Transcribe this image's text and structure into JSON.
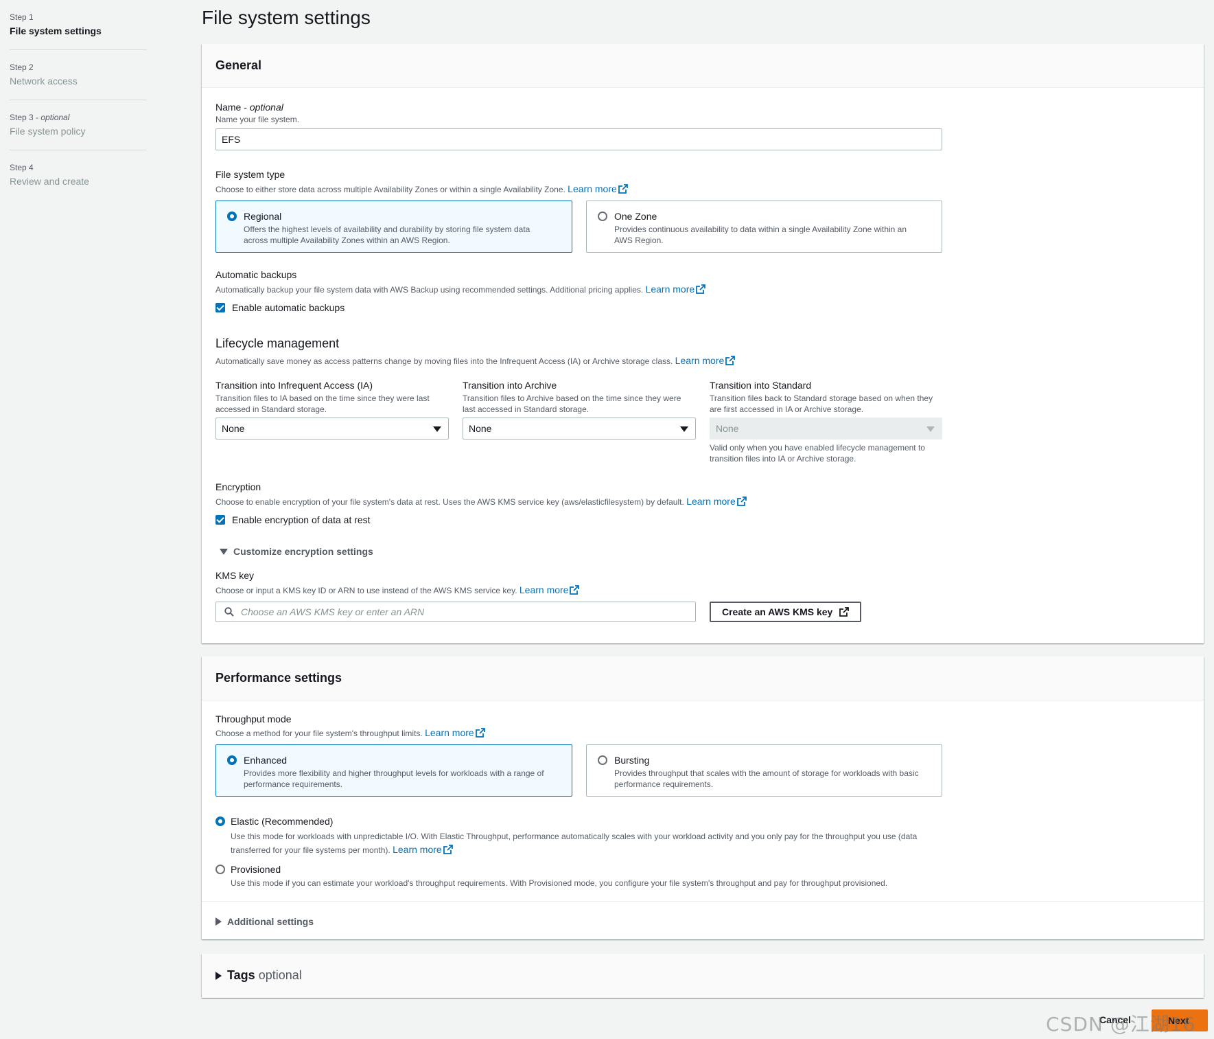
{
  "nav": {
    "steps": [
      {
        "num": "Step 1",
        "title": "File system settings"
      },
      {
        "num": "Step 2",
        "title": "Network access"
      },
      {
        "num": "Step 3",
        "num_optional": "optional",
        "title": "File system policy"
      },
      {
        "num": "Step 4",
        "title": "Review and create"
      }
    ]
  },
  "page_title": "File system settings",
  "general": {
    "header": "General",
    "name": {
      "label": "Name",
      "label_optional": "optional",
      "desc": "Name your file system.",
      "value": "EFS"
    },
    "fs_type": {
      "label": "File system type",
      "desc": "Choose to either store data across multiple Availability Zones or within a single Availability Zone.",
      "learn_more": "Learn more",
      "options": [
        {
          "title": "Regional",
          "desc_line1": "Offers the highest levels of availability and durability by storing file system data",
          "desc_line2": "across multiple Availability Zones within an AWS Region.",
          "selected": true
        },
        {
          "title": "One Zone",
          "desc_line1": "Provides continuous availability to data within a single Availability Zone within an",
          "desc_line2": "AWS Region.",
          "selected": false
        }
      ]
    },
    "backups": {
      "label": "Automatic backups",
      "desc": "Automatically backup your file system data with AWS Backup using recommended settings. Additional pricing applies.",
      "learn_more": "Learn more",
      "checkbox_label": "Enable automatic backups",
      "checked": true
    },
    "lifecycle": {
      "heading": "Lifecycle management",
      "desc": "Automatically save money as access patterns change by moving files into the Infrequent Access (IA) or Archive storage class.",
      "learn_more": "Learn more",
      "columns": [
        {
          "label": "Transition into Infrequent Access (IA)",
          "desc_line1": "Transition files to IA based on the time since they were last",
          "desc_line2": "accessed in Standard storage.",
          "value": "None"
        },
        {
          "label": "Transition into Archive",
          "desc_line1": "Transition files to Archive based on the time since they were",
          "desc_line2": "last accessed in Standard storage.",
          "value": "None"
        },
        {
          "label": "Transition into Standard",
          "desc_line1": "Transition files back to Standard storage based on when they",
          "desc_line2": "are first accessed in IA or Archive storage.",
          "value": "None",
          "note_line1": "Valid only when you have enabled lifecycle management to",
          "note_line2": "transition files into IA or Archive storage."
        }
      ]
    },
    "encryption": {
      "label": "Encryption",
      "desc": "Choose to enable encryption of your file system's data at rest. Uses the AWS KMS service key (aws/elasticfilesystem) by default.",
      "learn_more": "Learn more",
      "checkbox_label": "Enable encryption of data at rest",
      "checked": true,
      "customize_label": "Customize encryption settings",
      "kms_label": "KMS key",
      "kms_desc": "Choose or input a KMS key ID or ARN to use instead of the AWS KMS service key.",
      "kms_learn_more": "Learn more",
      "kms_placeholder": "Choose an AWS KMS key or enter an ARN",
      "create_key_button": "Create an AWS KMS key"
    }
  },
  "performance": {
    "header": "Performance settings",
    "throughput": {
      "label": "Throughput mode",
      "desc": "Choose a method for your file system's throughput limits.",
      "learn_more": "Learn more",
      "options": [
        {
          "title": "Enhanced",
          "desc_line1": "Provides more flexibility and higher throughput levels for workloads with a range of",
          "desc_line2": "performance requirements.",
          "selected": true
        },
        {
          "title": "Bursting",
          "desc_line1": "Provides throughput that scales with the amount of storage for workloads with basic",
          "desc_line2": "performance requirements.",
          "selected": false
        }
      ]
    },
    "elastic": {
      "title": "Elastic (Recommended)",
      "desc_line1": "Use this mode for workloads with unpredictable I/O. With Elastic Throughput, performance automatically scales with your workload activity and you only pay for the throughput you use (data",
      "desc_line2": "transferred for your file systems per month).",
      "learn_more": "Learn more",
      "selected": true
    },
    "provisioned": {
      "title": "Provisioned",
      "desc": "Use this mode if you can estimate your workload's throughput requirements. With Provisioned mode, you configure your file system's throughput and pay for throughput provisioned.",
      "selected": false
    },
    "additional": "Additional settings"
  },
  "tags": {
    "title": "Tags",
    "optional": "optional"
  },
  "footer": {
    "cancel": "Cancel",
    "next": "Next"
  },
  "watermark": "CSDN @江湖16",
  "colors": {
    "accent": "#0073bb",
    "primary_button": "#ec7211"
  }
}
